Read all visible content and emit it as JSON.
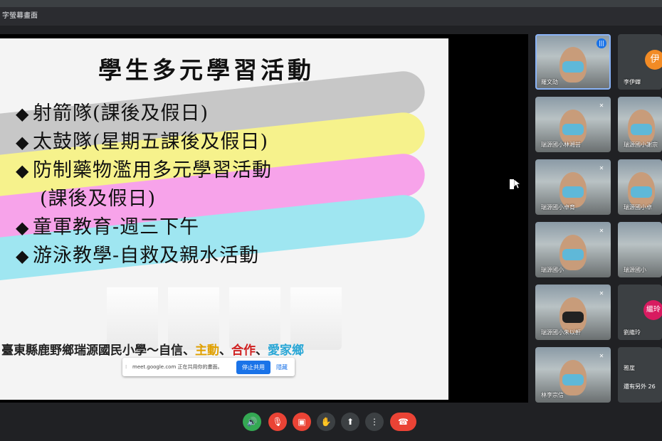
{
  "window": {
    "title": "字螢幕畫面"
  },
  "slide": {
    "title": "學生多元學習活動",
    "bullet_marker": "◆",
    "bullets": [
      "射箭隊(課後及假日)",
      "太鼓隊(星期五課後及假日)",
      "防制藥物濫用多元學習活動",
      "(課後及假日)",
      "童軍教育-週三下午",
      "游泳教學-自救及親水活動"
    ],
    "footer": {
      "prefix": "臺東縣鹿野鄉瑞源國民小學～自信、",
      "w1": "主動",
      "sep1": "、",
      "w2": "合作",
      "sep2": "、",
      "w3": "愛家鄉"
    },
    "rainbow_colors": [
      "#c7c7c7",
      "#f6f28c",
      "#f7a3ea",
      "#9fe6f1"
    ]
  },
  "share_bar": {
    "message": "meet.google.com 正在共用你的畫面。",
    "stop_label": "停止共用",
    "hide_label": "隱藏"
  },
  "participants": [
    {
      "name": "羅文劭",
      "type": "video",
      "speaking": true
    },
    {
      "name": "李伊蟬",
      "type": "avatar",
      "initial": "伊",
      "color": "#f28b25"
    },
    {
      "name": "瑞源國小林湘芸",
      "type": "video",
      "muted": true
    },
    {
      "name": "瑞源國小謝宗",
      "type": "video"
    },
    {
      "name": "瑞源國小卓育",
      "type": "video",
      "muted": true
    },
    {
      "name": "瑞源國小卓",
      "type": "video"
    },
    {
      "name": "瑞源國小",
      "type": "video",
      "muted": true
    },
    {
      "name": "瑞源國小",
      "type": "video"
    },
    {
      "name": "瑞源國小朱以軒",
      "type": "video",
      "muted": true
    },
    {
      "name": "劉繼玲",
      "type": "avatar",
      "initial": "繼玲",
      "color": "#d81b60"
    },
    {
      "name": "林李宗信",
      "type": "video",
      "muted": true
    },
    {
      "name": "雅崖",
      "type": "overflow",
      "more_text": "還有另外 26"
    }
  ],
  "controls": {
    "audio_icon": "speaker-icon",
    "mic_icon": "mic-off-icon",
    "cam_icon": "camera-off-icon",
    "hand_icon": "hand-icon",
    "present_icon": "present-icon",
    "more_icon": "more-vert-icon",
    "hangup_icon": "hangup-icon"
  }
}
